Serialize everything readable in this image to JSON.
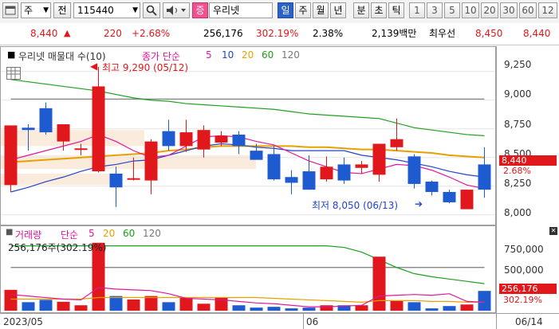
{
  "toolbar": {
    "market": "주",
    "mode": "전",
    "code": "115440",
    "badge": "증",
    "name": "우리넷",
    "periods": [
      "일",
      "주",
      "월",
      "년",
      "분",
      "초",
      "틱"
    ],
    "selected_period": "일",
    "numbers": [
      "1",
      "3",
      "5",
      "10",
      "20",
      "30",
      "60",
      "12"
    ]
  },
  "quote": {
    "price": "8,440",
    "change": "220",
    "change_pct": "+2.68%",
    "volume": "256,176",
    "volume_ratio": "302.19%",
    "turnover_rate": "2.38%",
    "amount": "2,139백만",
    "best_ask_label": "최우선",
    "best_ask": "8,450",
    "best_bid": "8,440"
  },
  "price_pane": {
    "title": "우리넷 매물대 수(10)",
    "ma_prefix": "종가 단순",
    "ma_periods": [
      "5",
      "10",
      "20",
      "60",
      "120"
    ],
    "ma_colors": {
      "5": "#e0179b",
      "10": "#2244c8",
      "20": "#e8a000",
      "60": "#1da01d",
      "120": "#777777"
    },
    "high_label": "최고 9,290 (05/12)",
    "low_label": "최저 8,050 (06/13)",
    "axis_ticks": [
      "9,250",
      "9,000",
      "8,750",
      "8,500",
      "8,250",
      "8,000"
    ],
    "last_price_tag": "8,440",
    "last_change_tag": "2.68%"
  },
  "volume_pane": {
    "title": "거래량",
    "ma_prefix": "단순",
    "ma_periods": [
      "5",
      "20",
      "60",
      "120"
    ],
    "ma_colors": {
      "5": "#e0179b",
      "20": "#e8a000",
      "60": "#1da01d",
      "120": "#777777"
    },
    "current": "256,176주(302.19%)",
    "axis_ticks": [
      "750,000",
      "500,000"
    ],
    "last_volume_tag": "256,176",
    "last_ratio_tag": "302.19%"
  },
  "date_axis": {
    "labels": [
      "2023/05",
      "06"
    ],
    "last": "06/14"
  },
  "chart_data": {
    "type": "candlestick",
    "ylim": [
      7950,
      9380
    ],
    "volume_ylim": [
      0,
      950000
    ],
    "candles": [
      {
        "o": 8260,
        "h": 8560,
        "l": 8200,
        "c": 8780,
        "v": 270000
      },
      {
        "o": 8760,
        "h": 8790,
        "l": 8560,
        "c": 8740,
        "v": 110000
      },
      {
        "o": 8930,
        "h": 8980,
        "l": 8700,
        "c": 8720,
        "v": 140000
      },
      {
        "o": 8640,
        "h": 8790,
        "l": 8560,
        "c": 8790,
        "v": 115000
      },
      {
        "o": 8570,
        "h": 8620,
        "l": 8520,
        "c": 8580,
        "v": 70000
      },
      {
        "o": 8380,
        "h": 9290,
        "l": 8370,
        "c": 9120,
        "v": 880000
      },
      {
        "o": 8360,
        "h": 8420,
        "l": 8070,
        "c": 8240,
        "v": 190000
      },
      {
        "o": 8310,
        "h": 8500,
        "l": 8300,
        "c": 8320,
        "v": 145000
      },
      {
        "o": 8300,
        "h": 8660,
        "l": 8180,
        "c": 8640,
        "v": 190000
      },
      {
        "o": 8730,
        "h": 8830,
        "l": 8560,
        "c": 8600,
        "v": 110000
      },
      {
        "o": 8600,
        "h": 8830,
        "l": 8550,
        "c": 8720,
        "v": 170000
      },
      {
        "o": 8570,
        "h": 8780,
        "l": 8500,
        "c": 8740,
        "v": 90000
      },
      {
        "o": 8630,
        "h": 8730,
        "l": 8600,
        "c": 8690,
        "v": 170000
      },
      {
        "o": 8700,
        "h": 8730,
        "l": 8530,
        "c": 8600,
        "v": 70000
      },
      {
        "o": 8560,
        "h": 8620,
        "l": 8500,
        "c": 8480,
        "v": 40000
      },
      {
        "o": 8530,
        "h": 8600,
        "l": 8300,
        "c": 8310,
        "v": 50000
      },
      {
        "o": 8330,
        "h": 8390,
        "l": 8180,
        "c": 8280,
        "v": 30000
      },
      {
        "o": 8380,
        "h": 8520,
        "l": 8220,
        "c": 8220,
        "v": 40000
      },
      {
        "o": 8310,
        "h": 8510,
        "l": 8290,
        "c": 8420,
        "v": 70000
      },
      {
        "o": 8440,
        "h": 8500,
        "l": 8270,
        "c": 8300,
        "v": 70000
      },
      {
        "o": 8410,
        "h": 8470,
        "l": 8360,
        "c": 8440,
        "v": 70000
      },
      {
        "o": 8350,
        "h": 8620,
        "l": 8290,
        "c": 8620,
        "v": 700000
      },
      {
        "o": 8590,
        "h": 8840,
        "l": 8560,
        "c": 8660,
        "v": 130000
      },
      {
        "o": 8510,
        "h": 8530,
        "l": 8230,
        "c": 8270,
        "v": 110000
      },
      {
        "o": 8290,
        "h": 8300,
        "l": 8170,
        "c": 8200,
        "v": 30000
      },
      {
        "o": 8200,
        "h": 8220,
        "l": 8100,
        "c": 8110,
        "v": 60000
      },
      {
        "o": 8050,
        "h": 8220,
        "l": 8050,
        "c": 8220,
        "v": 80000
      },
      {
        "o": 8440,
        "h": 8590,
        "l": 8150,
        "c": 8220,
        "v": 256176
      }
    ],
    "ma5": [
      8480,
      8520,
      8560,
      8600,
      8640,
      8700,
      8640,
      8560,
      8500,
      8520,
      8600,
      8680,
      8690,
      8680,
      8640,
      8610,
      8540,
      8470,
      8420,
      8370,
      8360,
      8400,
      8440,
      8430,
      8390,
      8330,
      8260,
      8230
    ],
    "ma10": [
      8200,
      8240,
      8290,
      8330,
      8380,
      8420,
      8440,
      8470,
      8480,
      8520,
      8560,
      8600,
      8620,
      8610,
      8590,
      8580,
      8560,
      8560,
      8560,
      8560,
      8520,
      8500,
      8480,
      8450,
      8420,
      8380,
      8350,
      8330
    ],
    "ma20": [
      8460,
      8470,
      8480,
      8490,
      8500,
      8510,
      8520,
      8530,
      8540,
      8560,
      8570,
      8590,
      8600,
      8600,
      8600,
      8600,
      8600,
      8590,
      8590,
      8580,
      8570,
      8570,
      8560,
      8550,
      8540,
      8520,
      8510,
      8500
    ],
    "ma60": [
      9180,
      9160,
      9140,
      9120,
      9100,
      9080,
      9050,
      9020,
      9000,
      8990,
      8970,
      8960,
      8950,
      8940,
      8930,
      8920,
      8900,
      8880,
      8870,
      8860,
      8850,
      8840,
      8800,
      8760,
      8740,
      8720,
      8700,
      8690
    ],
    "ma120": [
      9010,
      9010,
      9010,
      9010,
      9010,
      9010,
      9010,
      9010,
      9010,
      9010,
      9010,
      9010,
      9010,
      9010,
      9010,
      9010,
      9010,
      9010,
      9010,
      9010,
      9010,
      9010,
      9010,
      9010,
      9010,
      9010,
      9010,
      9010
    ],
    "vol_ma5": [
      210000,
      190000,
      170000,
      150000,
      140000,
      300000,
      280000,
      270000,
      260000,
      220000,
      160000,
      150000,
      140000,
      120000,
      100000,
      90000,
      70000,
      50000,
      50000,
      60000,
      70000,
      190000,
      200000,
      210000,
      200000,
      220000,
      120000,
      110000
    ],
    "vol_ma20": [
      150000,
      150000,
      150000,
      150000,
      150000,
      170000,
      170000,
      170000,
      170000,
      170000,
      170000,
      170000,
      170000,
      170000,
      170000,
      160000,
      150000,
      140000,
      130000,
      120000,
      110000,
      130000,
      130000,
      130000,
      120000,
      120000,
      110000,
      110000
    ],
    "vol_ma60": [
      840000,
      840000,
      840000,
      840000,
      840000,
      840000,
      840000,
      840000,
      840000,
      840000,
      840000,
      840000,
      840000,
      840000,
      840000,
      840000,
      840000,
      840000,
      840000,
      820000,
      760000,
      660000,
      560000,
      480000,
      440000,
      410000,
      380000,
      350000
    ],
    "vol_ma120": [
      560000,
      560000,
      560000,
      560000,
      560000,
      560000,
      560000,
      560000,
      560000,
      560000,
      560000,
      560000,
      560000,
      560000,
      560000,
      560000,
      560000,
      560000,
      560000,
      560000,
      560000,
      560000,
      560000,
      560000,
      560000,
      560000,
      560000,
      560000
    ]
  }
}
